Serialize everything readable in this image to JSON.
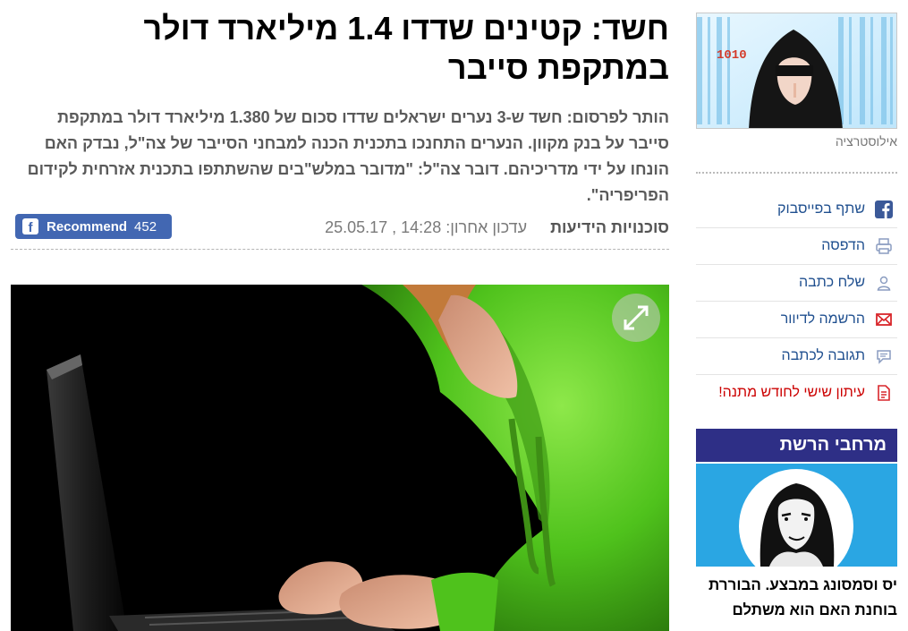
{
  "article": {
    "headline": "חשד: קטינים שדדו 1.4 מיליארד דולר במתקפת סייבר",
    "subhead": "הותר לפרסום: חשד ש-3 נערים ישראלים שדדו סכום של 1.380 מיליארד דולר במתקפת סייבר על בנק מקוון. הנערים התחנכו בתכנית הכנה למבחני הסייבר של צה\"ל, נבדק האם הונחו על ידי מדריכיהם. דובר צה\"ל: \"מדובר במלש\"בים שהשתתפו בתכנית אזרחית לקידום הפריפריה\".",
    "source": "סוכנויות הידיעות",
    "updated_label": "עדכון אחרון:",
    "updated_value": "25.05.17 , 14:28",
    "recommend_label": "Recommend",
    "recommend_count": "452",
    "fb_glyph": "f"
  },
  "sidebar": {
    "thumb_caption": "אילוסטרציה",
    "thumb_text": "1010",
    "share_items": [
      {
        "label": "שתף בפייסבוק",
        "icon": "facebook-icon"
      },
      {
        "label": "הדפסה",
        "icon": "print-icon"
      },
      {
        "label": "שלח כתבה",
        "icon": "person-icon"
      },
      {
        "label": "הרשמה לדיוור",
        "icon": "mail-icon"
      },
      {
        "label": "תגובה לכתבה",
        "icon": "comment-icon"
      },
      {
        "label": "עיתון שישי לחודש מתנה!",
        "icon": "document-icon"
      }
    ],
    "promo_title": "מרחבי הרשת",
    "promo_text": "יס וסמסונג במבצע. הבוררת בוחנת האם הוא משתלם"
  },
  "colors": {
    "link_blue": "#1f4f8f",
    "promo_header": "#2e2f86",
    "fb_blue": "#4267b2",
    "alert_red": "#cc0000",
    "hoodie_green": "#5fcf2a"
  }
}
